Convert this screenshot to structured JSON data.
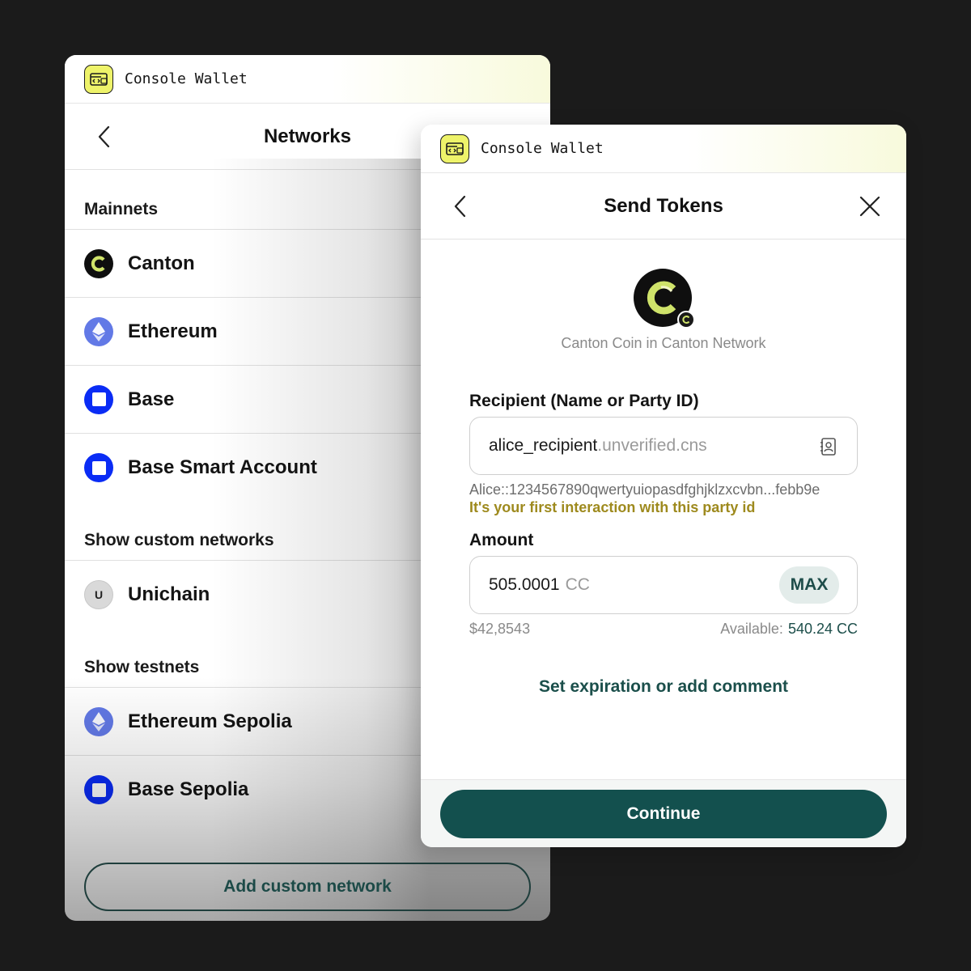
{
  "networks_panel": {
    "app_title": "Console Wallet",
    "title": "Networks",
    "sections": {
      "mainnets": "Mainnets",
      "custom": "Show custom networks",
      "testnets": "Show testnets"
    },
    "mainnets": [
      {
        "name": "Canton",
        "icon": "canton-icon"
      },
      {
        "name": "Ethereum",
        "icon": "ethereum-icon"
      },
      {
        "name": "Base",
        "icon": "base-icon"
      },
      {
        "name": "Base Smart Account",
        "icon": "base-icon"
      }
    ],
    "custom_networks": [
      {
        "name": "Unichain",
        "icon": "unichain-icon",
        "glyph": "U"
      }
    ],
    "testnets": [
      {
        "name": "Ethereum Sepolia",
        "icon": "ethereum-icon"
      },
      {
        "name": "Base Sepolia",
        "icon": "base-icon"
      }
    ],
    "add_button": "Add custom network"
  },
  "send_panel": {
    "app_title": "Console Wallet",
    "title": "Send Tokens",
    "token_caption": "Canton Coin in Canton Network",
    "recipient": {
      "label": "Recipient (Name or Party ID)",
      "value": "alice_recipient",
      "suffix": ".unverified.cns",
      "party_id": "Alice::1234567890qwertyuiopasdfghjklzxcvbn...febb9e",
      "warning": "It's your first interaction with this party id"
    },
    "amount": {
      "label": "Amount",
      "value": "505.0001",
      "unit": "CC",
      "max_label": "MAX",
      "usd_value": "$42,8543",
      "available_label": "Available:",
      "available_value": "540.24 CC"
    },
    "options_link": "Set expiration or add comment",
    "continue_label": "Continue"
  },
  "colors": {
    "background": "#1b1b1b",
    "accent_dark_teal": "#13504e",
    "logo_yellow": "#eef36a",
    "warning_olive": "#9e8a1e",
    "ethereum": "#6279e6",
    "base": "#0a2cf5"
  }
}
